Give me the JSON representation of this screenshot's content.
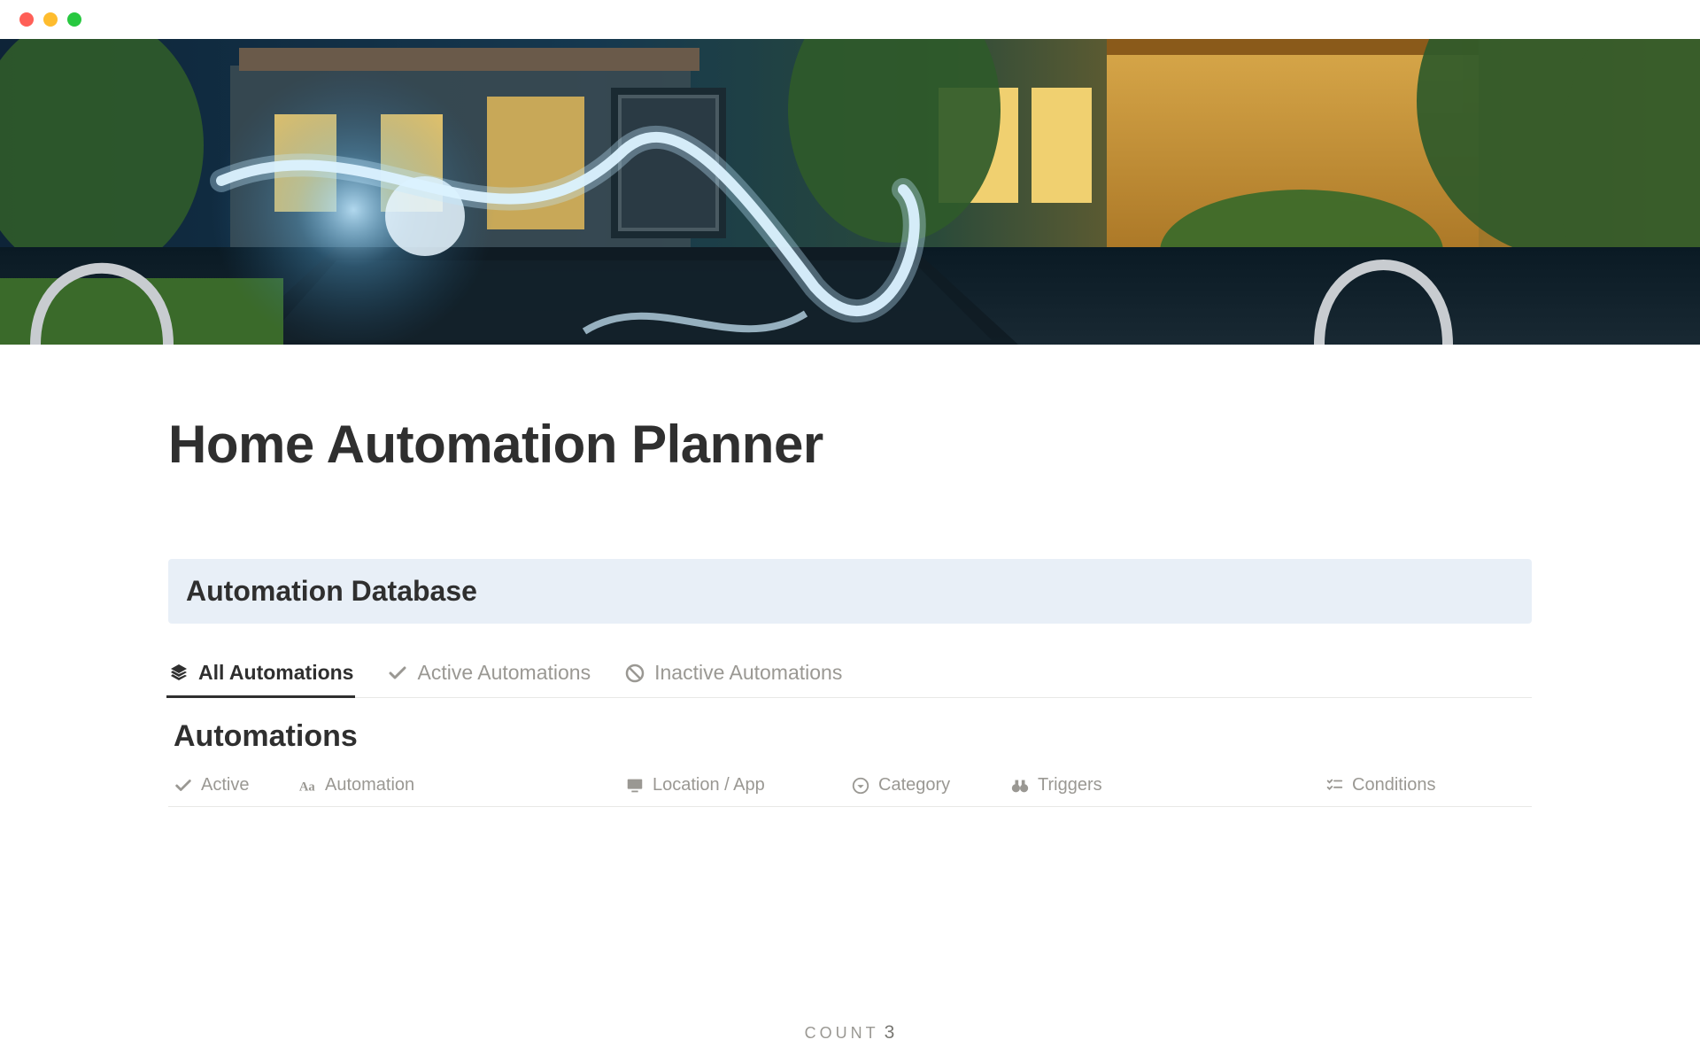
{
  "page": {
    "title": "Home Automation Planner"
  },
  "callout": {
    "title": "Automation Database"
  },
  "tabs": [
    {
      "label": "All Automations",
      "active": true
    },
    {
      "label": "Active Automations",
      "active": false
    },
    {
      "label": "Inactive Automations",
      "active": false
    }
  ],
  "section": {
    "title": "Automations"
  },
  "columns": {
    "active": "Active",
    "automation": "Automation",
    "location": "Location / App",
    "category": "Category",
    "triggers": "Triggers",
    "conditions": "Conditions"
  },
  "footer": {
    "label": "COUNT",
    "value": "3"
  }
}
